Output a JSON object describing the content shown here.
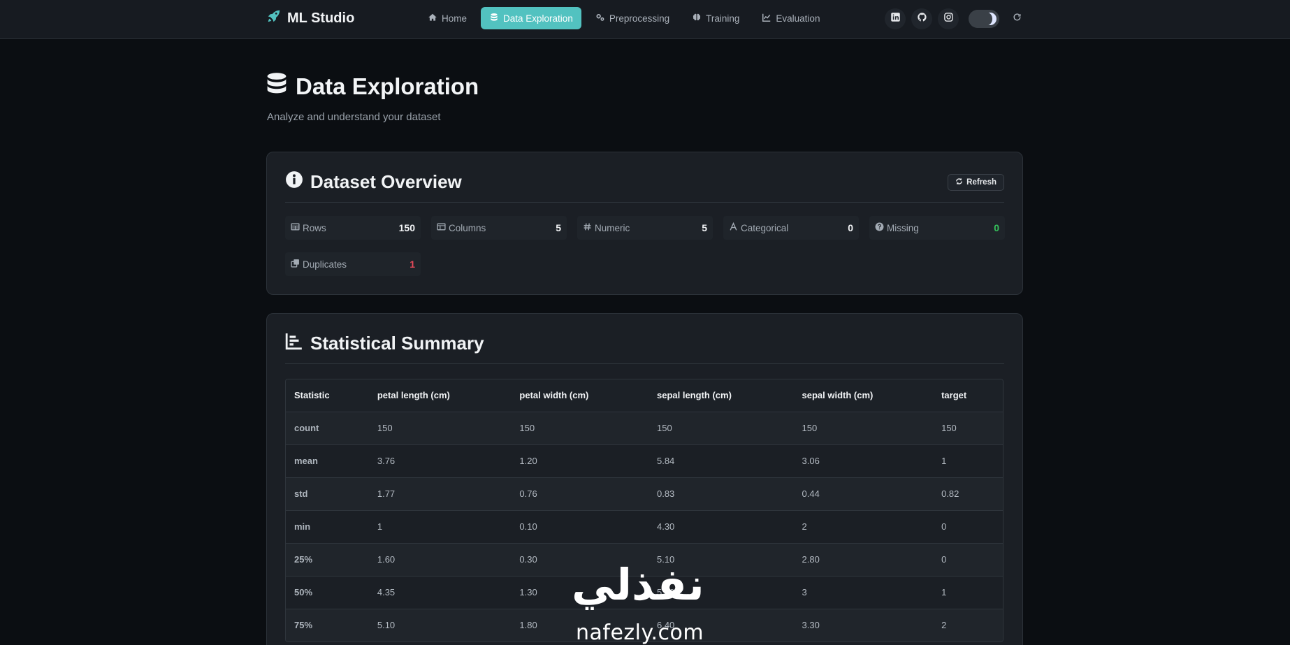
{
  "brand": {
    "name": "ML Studio"
  },
  "nav": {
    "items": [
      {
        "label": "Home",
        "icon": "home-icon",
        "active": false
      },
      {
        "label": "Data Exploration",
        "icon": "database-icon",
        "active": true
      },
      {
        "label": "Preprocessing",
        "icon": "gears-icon",
        "active": false
      },
      {
        "label": "Training",
        "icon": "brain-icon",
        "active": false
      },
      {
        "label": "Evaluation",
        "icon": "chart-line-icon",
        "active": false
      }
    ],
    "social": [
      "linkedin-icon",
      "github-icon",
      "instagram-icon"
    ],
    "theme": "dark"
  },
  "page": {
    "title": "Data Exploration",
    "subtitle": "Analyze and understand your dataset"
  },
  "overview": {
    "title": "Dataset Overview",
    "refresh_label": "Refresh",
    "metrics": [
      {
        "label": "Rows",
        "value": "150",
        "icon": "table-icon"
      },
      {
        "label": "Columns",
        "value": "5",
        "icon": "columns-icon"
      },
      {
        "label": "Numeric",
        "value": "5",
        "icon": "hashtag-icon"
      },
      {
        "label": "Categorical",
        "value": "0",
        "icon": "font-icon"
      },
      {
        "label": "Missing",
        "value": "0",
        "icon": "question-circle-icon"
      },
      {
        "label": "Duplicates",
        "value": "1",
        "icon": "clone-icon"
      }
    ]
  },
  "stats": {
    "title": "Statistical Summary",
    "headers": [
      "Statistic",
      "petal length (cm)",
      "petal width (cm)",
      "sepal length (cm)",
      "sepal width (cm)",
      "target"
    ],
    "rows": [
      [
        "count",
        "150",
        "150",
        "150",
        "150",
        "150"
      ],
      [
        "mean",
        "3.76",
        "1.20",
        "5.84",
        "3.06",
        "1"
      ],
      [
        "std",
        "1.77",
        "0.76",
        "0.83",
        "0.44",
        "0.82"
      ],
      [
        "min",
        "1",
        "0.10",
        "4.30",
        "2",
        "0"
      ],
      [
        "25%",
        "1.60",
        "0.30",
        "5.10",
        "2.80",
        "0"
      ],
      [
        "50%",
        "4.35",
        "1.30",
        "5.80",
        "3",
        "1"
      ],
      [
        "75%",
        "5.10",
        "1.80",
        "6.40",
        "3.30",
        "2"
      ]
    ]
  },
  "watermark": {
    "arabic": "نفذلي",
    "latin": "nafezly.com"
  },
  "colors": {
    "accent": "#52c2c0",
    "success": "#35c15b",
    "danger": "#e64a5a",
    "background": "#0b0e12",
    "card": "#1b1f25"
  }
}
